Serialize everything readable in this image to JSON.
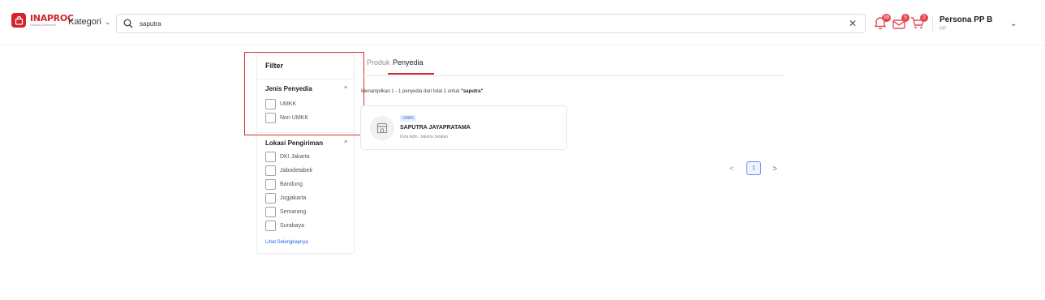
{
  "header": {
    "logo_text": "INAPROC",
    "logo_subtext": "Katalog Elektronik",
    "kategori_label": "Kategori",
    "search": {
      "value": "saputra",
      "placeholder": ""
    },
    "notifications": [
      {
        "name": "bell",
        "badge": "99"
      },
      {
        "name": "mail",
        "badge": "5"
      },
      {
        "name": "cart",
        "badge": "2"
      }
    ],
    "user": {
      "name": "Persona PP B",
      "role": "PP"
    }
  },
  "filter": {
    "title": "Filter",
    "sections": [
      {
        "title": "Jenis Penyedia",
        "options": [
          "UMKK",
          "Non UMKK"
        ]
      },
      {
        "title": "Lokasi Pengiriman",
        "options": [
          "DKI Jakarta",
          "Jabodetabek",
          "Bandung",
          "Jogjakarta",
          "Semarang",
          "Surabaya"
        ]
      }
    ],
    "more_link": "Lihat Selengkapnya"
  },
  "tabs": {
    "items": [
      "Produk",
      "Penyedia"
    ],
    "active": "Penyedia"
  },
  "results": {
    "prefix": "Menampilkan 1 - 1 penyedia dari total 1 untuk ",
    "query": "\"saputra\""
  },
  "vendor_card": {
    "badge": "UMKK",
    "name": "SAPUTRA JAYAPRATAMA",
    "location": "Kota Adm. Jakarta Selatan"
  },
  "pagination": {
    "current_page": "1",
    "prev": "<",
    "next": ">"
  },
  "colors": {
    "brand": "#d3242b",
    "accent": "#3b6fd1",
    "highlight": "#d32f2f"
  }
}
